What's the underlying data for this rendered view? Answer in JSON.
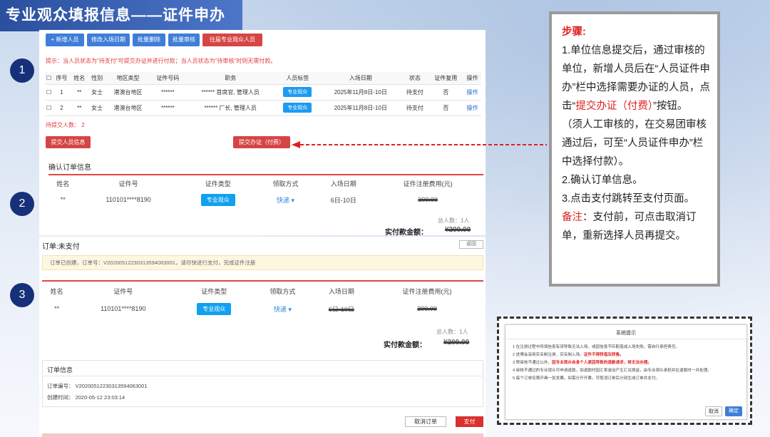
{
  "page_title": "专业观众填报信息——证件申办",
  "steps": [
    "1",
    "2",
    "3"
  ],
  "section1": {
    "buttons": {
      "add": "+ 新增人员",
      "edit_date": "修改入场日期",
      "batch_delete": "批量删除",
      "batch_review": "批量审核",
      "past": "往届专业观众人员"
    },
    "hint": "提示：当人员状态为\"待支付\"可提交办证并进行付款；当人员状态为\"待审核\"时则无需付款。",
    "columns": [
      "",
      "序号",
      "姓名",
      "性别",
      "地区类型",
      "证件号码",
      "职务",
      "人员标签",
      "入场日期",
      "状态",
      "证件复用",
      "操作"
    ],
    "rows": [
      {
        "idx": "1",
        "name": "**",
        "gender": "女士",
        "region": "港澳台地区",
        "id": "******",
        "title": "****** 首席官, 管理人员",
        "tag": "专业观众",
        "date": "2025年11月8日-10日",
        "status": "待支付",
        "reuse": "否",
        "op": "操作"
      },
      {
        "idx": "2",
        "name": "**",
        "gender": "女士",
        "region": "港澳台地区",
        "id": "******",
        "title": "****** 厂长, 管理人员",
        "tag": "专业观众",
        "date": "2025年11月8日-10日",
        "status": "待支付",
        "reuse": "否",
        "op": "操作"
      }
    ],
    "pending": "待提交人数： 2",
    "submit_info": "提交人员信息",
    "submit_pay": "提交办证（付费）"
  },
  "section2": {
    "heading": "确认订单信息",
    "columns": [
      "姓名",
      "证件号",
      "证件类型",
      "领取方式",
      "入场日期",
      "证件注册费用(元)"
    ],
    "row": {
      "name": "**",
      "id": "110101****8190",
      "type": "专业观众",
      "pickup": "快递 ▾",
      "date": "6日-10日",
      "fee": "200.00"
    },
    "total_people": "总人数：1人",
    "payable_label": "实付款金额：",
    "payable_value": "¥200.00"
  },
  "section3": {
    "order_status": "订单:未支付",
    "back": "返回",
    "notice": "订单已创建，订单号：V20200512230313594063001，请尽快进行支付，完成证件注册",
    "columns": [
      "姓名",
      "证件号",
      "证件类型",
      "领取方式",
      "入场日期",
      "证件注册费用(元)"
    ],
    "row": {
      "name": "**",
      "id": "110101****8190",
      "type": "专业观众",
      "pickup": "快递 ▾",
      "date": "6日-10日",
      "fee": "200.00"
    },
    "total_people": "总人数：1人",
    "payable_label": "实付款金额：",
    "payable_value": "¥200.00",
    "order_info_heading": "订单信息",
    "order_no": "订单编号：  V20200512230313594063001",
    "created": "创建时间：  2020-05-12 23:03:14",
    "cancel": "取消订单",
    "pay": "支付"
  },
  "instructions": {
    "heading": "步骤:",
    "s1a": "1.单位信息提交后，通过审核的单位，新增人员后在“人员证件申办”栏中选择需要办证的人员，点击“",
    "s1b": "提交办证（付费）",
    "s1c": "”按钮。",
    "s1d": "（须人工审核的，在交易团审核通过后，可至“人员证件申办”栏中选择付款）。",
    "s2": "2.确认订单信息。",
    "s3": "3.点击支付跳转至支付页面。",
    "note_label": "备注",
    "note": "：支付前，可点击取消订单，重新选择人员再提交。"
  },
  "dialog": {
    "title": "系统提示",
    "l1": "1 在注册过程中所填信息有误导致无法入场，或因信息不匹配造成入场失败，需自行承担责任。",
    "l2a": "2 进博会采用实名制注册，实名制入场，",
    "l2b": "证件不得转借及转售。",
    "l3a": "3 除审核不通过以外，",
    "l3b": "因专业观众自身个人原因导致的退款请求，将无法办理。",
    "l4": "4 审核不通过的专业观众可申请退款，如退款时因汇率波动产生汇兑损益，由专业观众承担并在退款时一并处理。",
    "l5": "5 每个订单仅限开具一张发票。如需分开开票，可取消订单后分别生成订单并支付。",
    "cancel": "取消",
    "confirm": "确定"
  },
  "colors": {
    "accent_red": "#d64545",
    "accent_blue": "#3f7ed8",
    "step_badge": "#17307a"
  }
}
